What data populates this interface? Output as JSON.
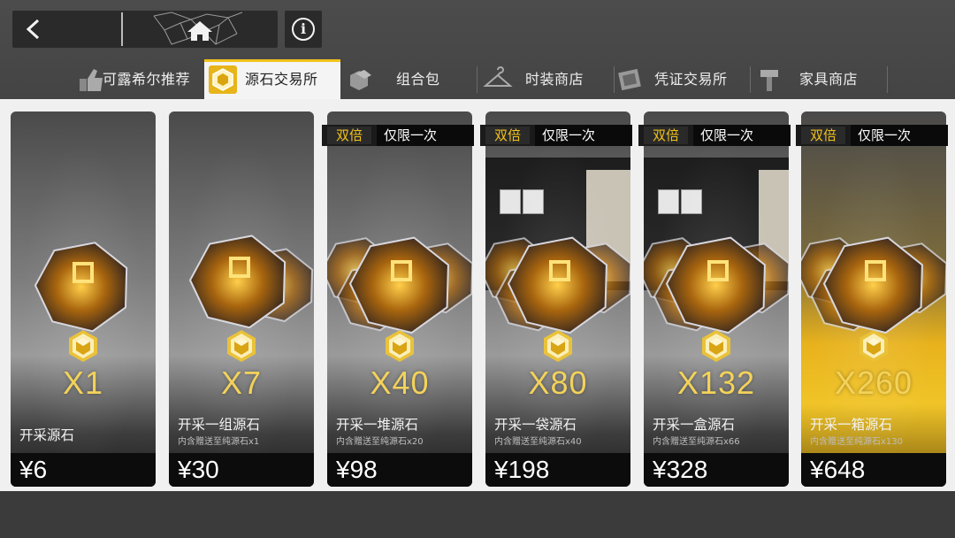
{
  "header": {
    "back_icon": "chevron-left-icon",
    "home_icon": "home-icon",
    "info_icon": "info-icon",
    "info_glyph": "i"
  },
  "tabs": [
    {
      "label": "可露希尔推荐",
      "icon": "thumbs-up-icon",
      "active": false
    },
    {
      "label": "源石交易所",
      "icon": "originite-icon",
      "active": true
    },
    {
      "label": "组合包",
      "icon": "bundle-icon",
      "active": false
    },
    {
      "label": "时装商店",
      "icon": "hanger-icon",
      "active": false
    },
    {
      "label": "凭证交易所",
      "icon": "voucher-icon",
      "active": false
    },
    {
      "label": "家具商店",
      "icon": "hammer-icon",
      "active": false
    }
  ],
  "cards": [
    {
      "qty": "X1",
      "title": "开采源石",
      "sub": "",
      "price": "¥6",
      "badge": false
    },
    {
      "qty": "X7",
      "title": "开采一组源石",
      "sub": "内含赠送至纯源石x1",
      "price": "¥30",
      "badge": false
    },
    {
      "qty": "X40",
      "title": "开采一堆源石",
      "sub": "内含赠送至纯源石x20",
      "price": "¥98",
      "badge": true
    },
    {
      "qty": "X80",
      "title": "开采一袋源石",
      "sub": "内含赠送至纯源石x40",
      "price": "¥198",
      "badge": true
    },
    {
      "qty": "X132",
      "title": "开采一盒源石",
      "sub": "内含赠送至纯源石x66",
      "price": "¥328",
      "badge": true
    },
    {
      "qty": "X260",
      "title": "开采一箱源石",
      "sub": "内含赠送至纯源石x130",
      "price": "¥648",
      "badge": true
    }
  ],
  "badge": {
    "double": "双倍",
    "once": "仅限一次"
  },
  "colors": {
    "accent": "#f2c21a",
    "qty": "#f3d25a",
    "active_tab_bg": "#f4f4f4"
  }
}
